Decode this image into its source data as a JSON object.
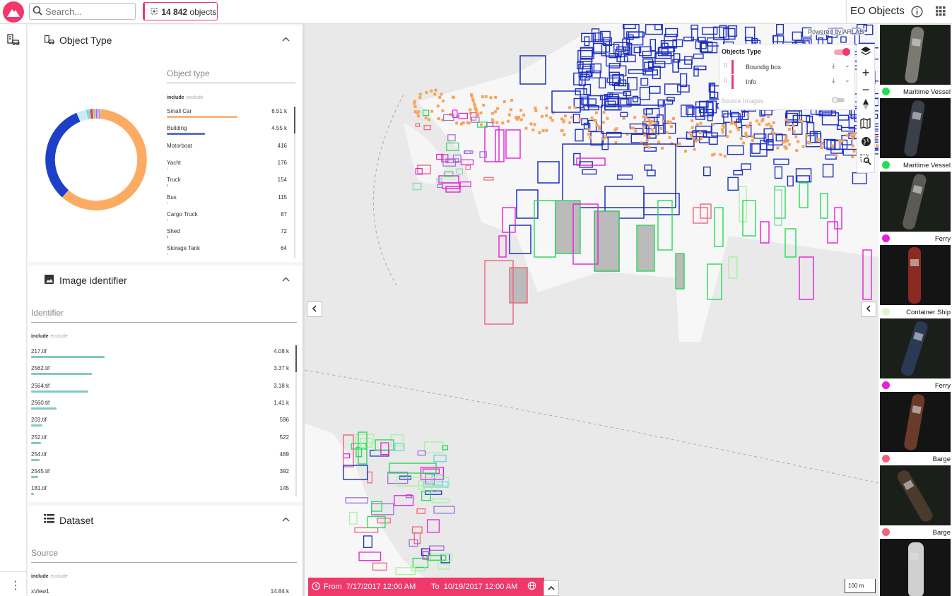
{
  "header": {
    "search_placeholder": "Search...",
    "count_value": "14 842",
    "count_unit": "objects",
    "app_title": "EO Objects",
    "accent_color": "#f0386b"
  },
  "rail": {
    "icon": "vehicles-icon",
    "more_icon": "more-vertical-icon"
  },
  "object_type": {
    "title": "Object Type",
    "field_label": "Object type",
    "include": "include",
    "exclude": "exclude",
    "items": [
      {
        "label": "Small Car",
        "value": "8.51 k",
        "color": "#f9b57f",
        "fraction": 1.0
      },
      {
        "label": "Building",
        "value": "4.55 k",
        "color": "#5c6fcf",
        "fraction": 0.54
      },
      {
        "label": "Motorboat",
        "value": "416",
        "color": "#eee",
        "fraction": 0.0
      },
      {
        "label": "Yacht",
        "value": "176",
        "color": "#cfe9f6",
        "fraction": 0.02
      },
      {
        "label": "Truck",
        "value": "154",
        "color": "#f9a060",
        "fraction": 0.02
      },
      {
        "label": "Bus",
        "value": "115",
        "color": "#aaf3df",
        "fraction": 0.01
      },
      {
        "label": "Cargo Truck",
        "value": "87",
        "color": "#f6c6d6",
        "fraction": 0.01
      },
      {
        "label": "Shed",
        "value": "72",
        "color": "#6bd97b",
        "fraction": 0.01
      },
      {
        "label": "Storage Tank",
        "value": "64",
        "color": "#e9e46a",
        "fraction": 0.01
      }
    ],
    "donut": [
      {
        "label": "Small Car",
        "value": 8510,
        "color": "#fcab63"
      },
      {
        "label": "Building",
        "value": 4550,
        "color": "#1e3fc8"
      },
      {
        "label": "Motorboat",
        "value": 416,
        "color": "#cfe9f6"
      },
      {
        "label": "Yacht",
        "value": 176,
        "color": "#7be0c7"
      },
      {
        "label": "Truck",
        "value": 154,
        "color": "#f0386b"
      },
      {
        "label": "Bus",
        "value": 115,
        "color": "#9ad86d"
      },
      {
        "label": "Cargo Truck",
        "value": 87,
        "color": "#e44be8"
      },
      {
        "label": "Shed",
        "value": 72,
        "color": "#69d1e8"
      },
      {
        "label": "Storage Tank",
        "value": 64,
        "color": "#a06ddd"
      }
    ]
  },
  "image_identifier": {
    "title": "Image identifier",
    "field_label": "Identifier",
    "include": "include",
    "exclude": "exclude",
    "bar_color": "#80cbc4",
    "items": [
      {
        "label": "217.tif",
        "value": "4.08 k",
        "fraction": 1.0
      },
      {
        "label": "2562.tif",
        "value": "3.37 k",
        "fraction": 0.83
      },
      {
        "label": "2564.tif",
        "value": "3.18 k",
        "fraction": 0.78
      },
      {
        "label": "2560.tif",
        "value": "1.41 k",
        "fraction": 0.35
      },
      {
        "label": "203.tif",
        "value": "596",
        "fraction": 0.15
      },
      {
        "label": "252.tif",
        "value": "522",
        "fraction": 0.13
      },
      {
        "label": "254.tif",
        "value": "489",
        "fraction": 0.12
      },
      {
        "label": "2545.tif",
        "value": "392",
        "fraction": 0.1
      },
      {
        "label": "181.tif",
        "value": "145",
        "fraction": 0.04
      }
    ]
  },
  "dataset": {
    "title": "Dataset",
    "field_label": "Source",
    "include": "include",
    "exclude": "exclude",
    "items": [
      {
        "label": "xView1",
        "value": "14.84 k"
      }
    ]
  },
  "map": {
    "powered_by": "Powered by ARLAS",
    "layers_title": "Objects Type",
    "layers": [
      {
        "label": "Boundig box"
      },
      {
        "label": "Info"
      }
    ],
    "source_images": "Source Images",
    "scale": "100 m",
    "timeline_from_label": "From",
    "timeline_from": "7/17/2017 12:00 AM",
    "timeline_to_label": "To",
    "timeline_to": "10/19/2017 12:00 AM"
  },
  "results": [
    {
      "label": "Maritime Vessel",
      "color": "#22dd55"
    },
    {
      "label": "Maritime Vessel",
      "color": "#22dd55"
    },
    {
      "label": "Ferry",
      "color": "#e81ed9"
    },
    {
      "label": "Container Ship",
      "color": "#e0f7c8"
    },
    {
      "label": "Ferry",
      "color": "#e81ed9"
    },
    {
      "label": "Barge",
      "color": "#f0647a"
    },
    {
      "label": "Barge",
      "color": "#f0647a"
    },
    {
      "label": "",
      "color": "#ffffff"
    }
  ]
}
